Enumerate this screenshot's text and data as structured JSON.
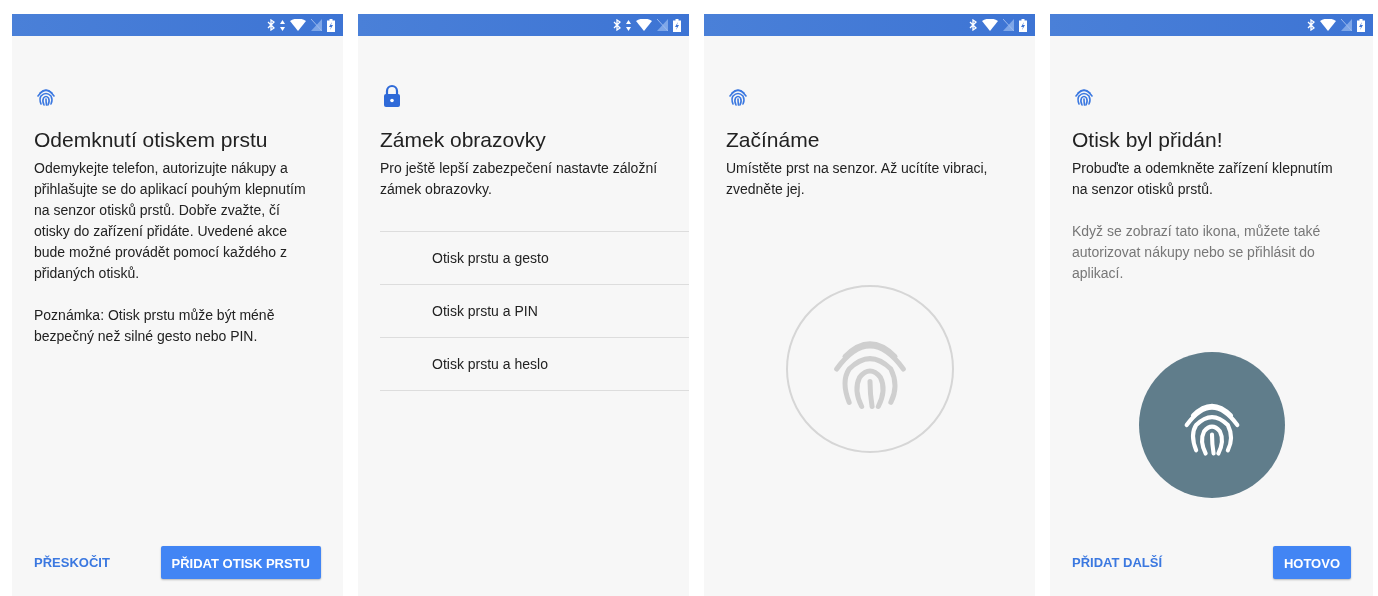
{
  "screens": [
    {
      "status_bar": {
        "data_activity": true
      },
      "header_icon": {
        "kind": "fingerprint"
      },
      "title": "Odemknutí otiskem prstu",
      "paragraphs": [
        {
          "text": "Odemykejte telefon, autorizujte nákupy a přihlašujte se do aplikací pouhým klepnutím na senzor otisků prstů. Dobře zvažte, čí otisky do zařízení přidáte. Uvedené akce bude možné provádět pomocí každého z přidaných otisků.",
          "muted": false
        },
        {
          "text": "Poznámka: Otisk prstu může být méně bezpečný než silné gesto nebo PIN.",
          "muted": false
        }
      ],
      "buttons": [
        {
          "label": "PŘESKOČIT",
          "kind": "text"
        },
        {
          "label": "PŘIDAT OTISK PRSTU",
          "kind": "raised"
        }
      ]
    },
    {
      "status_bar": {
        "data_activity": true
      },
      "header_icon": {
        "kind": "lock"
      },
      "title": "Zámek obrazovky",
      "paragraphs": [
        {
          "text": "Pro ještě lepší zabezpečení nastavte záložní zámek obrazovky.",
          "muted": false
        }
      ],
      "options": [
        "Otisk prstu a gesto",
        "Otisk prstu a PIN",
        "Otisk prstu a heslo"
      ]
    },
    {
      "status_bar": {
        "data_activity": false
      },
      "header_icon": {
        "kind": "fingerprint"
      },
      "title": "Začínáme",
      "paragraphs": [
        {
          "text": "Umístěte prst na senzor. Až ucítíte vibraci, zvedněte jej.",
          "muted": false
        }
      ],
      "illustration": {
        "kind": "outline"
      }
    },
    {
      "status_bar": {
        "data_activity": false
      },
      "header_icon": {
        "kind": "fingerprint"
      },
      "title": "Otisk byl přidán!",
      "paragraphs": [
        {
          "text": "Probuďte a odemkněte zařízení klepnutím na senzor otisků prstů.",
          "muted": false
        },
        {
          "text": "Když se zobrazí tato ikona, můžete také autorizovat nákupy nebo se přihlásit do aplikací.",
          "muted": true
        }
      ],
      "illustration": {
        "kind": "filled"
      },
      "buttons": [
        {
          "label": "PŘIDAT DALŠÍ",
          "kind": "text"
        },
        {
          "label": "HOTOVO",
          "kind": "raised"
        }
      ]
    }
  ]
}
